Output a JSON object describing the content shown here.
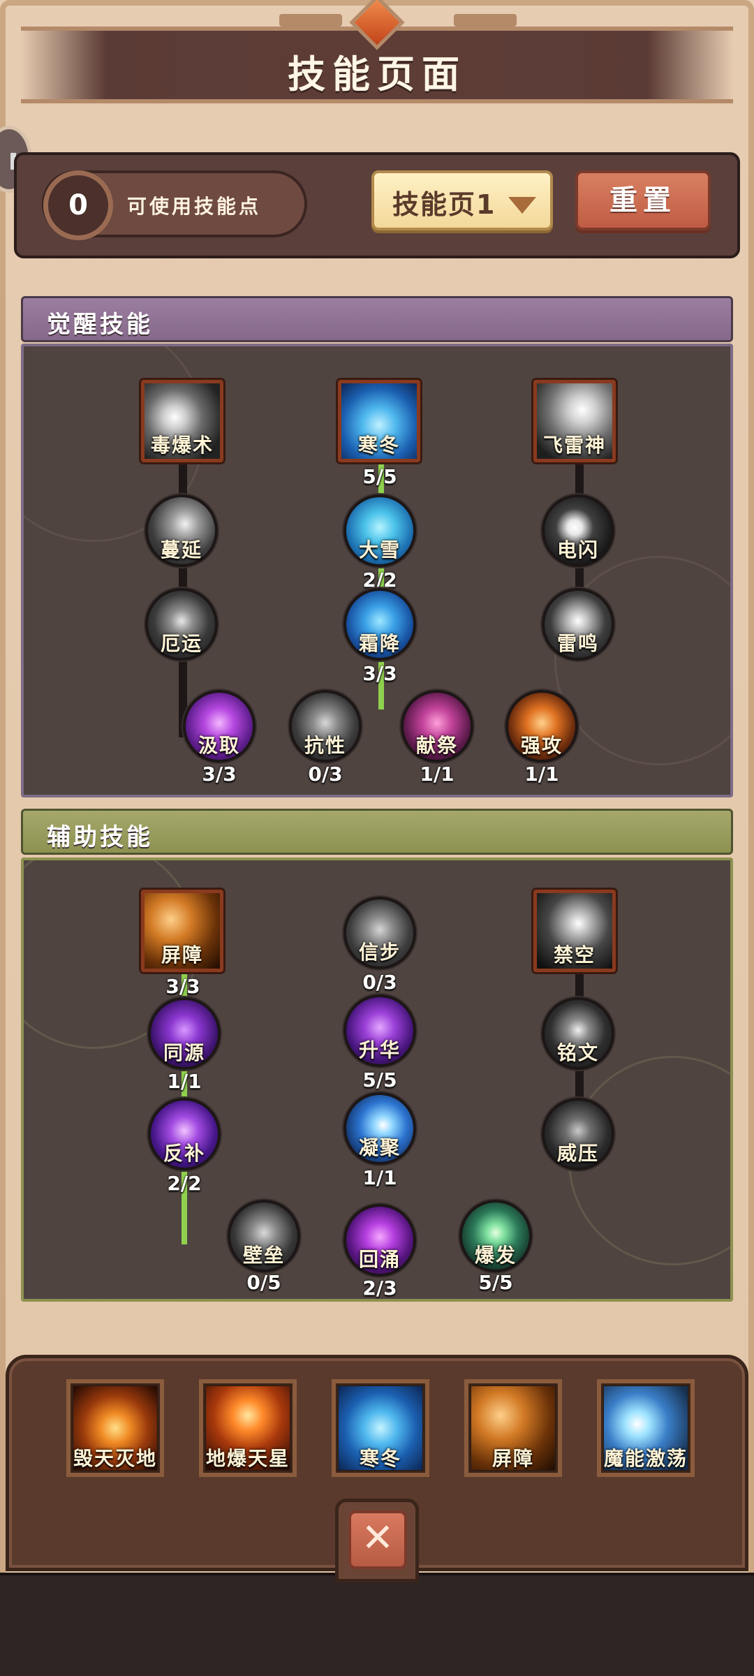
{
  "header": {
    "title": "技能页面"
  },
  "controls": {
    "points_value": "0",
    "points_label": "可使用技能点",
    "page_select_label": "技能页1",
    "reset_label": "重置"
  },
  "colors": {
    "awaken_header": "#9b7ea0",
    "assist_header": "#a5a86a",
    "active_link": "#8fd14f",
    "reset_button": "#d98062",
    "select_button": "#f3d89a"
  },
  "awaken": {
    "title": "觉醒技能",
    "nodes": [
      {
        "name": "毒爆术",
        "icon": "lightning-claw-icon",
        "level": ""
      },
      {
        "name": "寒冬",
        "icon": "ice-crystal-icon",
        "level": "5/5"
      },
      {
        "name": "飞雷神",
        "icon": "thunder-dragon-icon",
        "level": ""
      },
      {
        "name": "蔓延",
        "icon": "spreading-smoke-icon",
        "level": ""
      },
      {
        "name": "大雪",
        "icon": "snow-orb-icon",
        "level": "2/2"
      },
      {
        "name": "电闪",
        "icon": "lightning-bolt-icon",
        "level": ""
      },
      {
        "name": "厄运",
        "icon": "doom-swirl-icon",
        "level": ""
      },
      {
        "name": "霜降",
        "icon": "frost-shard-icon",
        "level": "3/3"
      },
      {
        "name": "汲取",
        "icon": "potion-icon",
        "level": "3/3"
      },
      {
        "name": "抗性",
        "icon": "crossed-swords-icon",
        "level": "0/3"
      },
      {
        "name": "献祭",
        "icon": "sacrifice-hand-icon",
        "level": "1/1"
      },
      {
        "name": "强攻",
        "icon": "claw-slash-icon",
        "level": "1/1"
      },
      {
        "name": "雷鸣",
        "icon": "thunder-storm-icon",
        "level": ""
      }
    ]
  },
  "assist": {
    "title": "辅助技能",
    "nodes": [
      {
        "name": "屏障",
        "icon": "barrier-orb-icon",
        "level": "3/3"
      },
      {
        "name": "信步",
        "icon": "boot-icon",
        "level": "0/3"
      },
      {
        "name": "禁空",
        "icon": "sealed-sky-icon",
        "level": ""
      },
      {
        "name": "同源",
        "icon": "cross-rune-icon",
        "level": "1/1"
      },
      {
        "name": "升华",
        "icon": "purple-swirl-icon",
        "level": "5/5"
      },
      {
        "name": "铭文",
        "icon": "rune-glyph-icon",
        "level": ""
      },
      {
        "name": "反补",
        "icon": "purple-burst-icon",
        "level": "2/2"
      },
      {
        "name": "凝聚",
        "icon": "blue-flash-icon",
        "level": "1/1"
      },
      {
        "name": "威压",
        "icon": "armored-helm-icon",
        "level": ""
      },
      {
        "name": "壁垒",
        "icon": "shield-gauntlet-icon",
        "level": "0/5"
      },
      {
        "name": "回涌",
        "icon": "purple-surge-icon",
        "level": "2/3"
      },
      {
        "name": "爆发",
        "icon": "green-burst-icon",
        "level": "5/5"
      }
    ]
  },
  "loadout": {
    "slots": [
      {
        "name": "毁天灭地",
        "icon": "fire-hammer-icon"
      },
      {
        "name": "地爆天星",
        "icon": "volcano-icon"
      },
      {
        "name": "寒冬",
        "icon": "ice-crystal-icon"
      },
      {
        "name": "屏障",
        "icon": "barrier-orb-icon"
      },
      {
        "name": "魔能激荡",
        "icon": "mage-lightning-icon"
      }
    ],
    "close_symbol": "✕"
  }
}
